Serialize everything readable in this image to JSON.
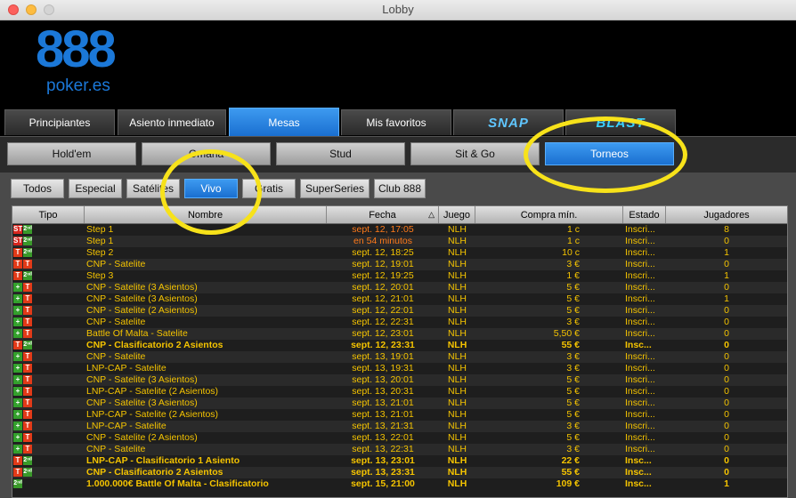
{
  "window": {
    "title": "Lobby"
  },
  "logo": {
    "number": "888",
    "text": "poker.es"
  },
  "main_tabs": [
    "Principiantes",
    "Asiento inmediato",
    "Mesas",
    "Mis favoritos",
    "SNAP",
    "BLAST"
  ],
  "main_tabs_active": "Mesas",
  "sub_tabs": [
    "Hold'em",
    "Omaha",
    "Stud",
    "Sit & Go",
    "Torneos"
  ],
  "sub_tabs_active": "Torneos",
  "filter_tabs": [
    "Todos",
    "Especial",
    "Satélites",
    "Vivo",
    "Gratis",
    "SuperSeries",
    "Club 888"
  ],
  "filter_tabs_active": "Vivo",
  "table": {
    "headers": {
      "tipo": "Tipo",
      "nombre": "Nombre",
      "fecha": "Fecha",
      "juego": "Juego",
      "compra": "Compra mín.",
      "estado": "Estado",
      "jugadores": "Jugadores"
    },
    "rows": [
      {
        "tipo": "st2",
        "nombre": "Step 1",
        "fecha": "sept. 12, 17:05",
        "juego": "NLH",
        "compra": "1 c",
        "estado": "Inscri...",
        "jugadores": "8",
        "warn": true,
        "bold": false
      },
      {
        "tipo": "st2",
        "nombre": "Step 1",
        "fecha": "en 54 minutos",
        "juego": "NLH",
        "compra": "1 c",
        "estado": "Inscri...",
        "jugadores": "0",
        "warn": true,
        "bold": false
      },
      {
        "tipo": "t2",
        "nombre": "Step 2",
        "fecha": "sept. 12, 18:25",
        "juego": "NLH",
        "compra": "10 c",
        "estado": "Inscri...",
        "jugadores": "1",
        "warn": false,
        "bold": false
      },
      {
        "tipo": "tt",
        "nombre": "CNP - Satelite",
        "fecha": "sept. 12, 19:01",
        "juego": "NLH",
        "compra": "3 €",
        "estado": "Inscri...",
        "jugadores": "0",
        "warn": false,
        "bold": false
      },
      {
        "tipo": "t2",
        "nombre": "Step 3",
        "fecha": "sept. 12, 19:25",
        "juego": "NLH",
        "compra": "1 €",
        "estado": "Inscri...",
        "jugadores": "1",
        "warn": false,
        "bold": false
      },
      {
        "tipo": "pt",
        "nombre": "CNP - Satelite (3 Asientos)",
        "fecha": "sept. 12, 20:01",
        "juego": "NLH",
        "compra": "5 €",
        "estado": "Inscri...",
        "jugadores": "0",
        "warn": false,
        "bold": false
      },
      {
        "tipo": "pt",
        "nombre": "CNP - Satelite (3 Asientos)",
        "fecha": "sept. 12, 21:01",
        "juego": "NLH",
        "compra": "5 €",
        "estado": "Inscri...",
        "jugadores": "1",
        "warn": false,
        "bold": false
      },
      {
        "tipo": "pt",
        "nombre": "CNP - Satelite (2 Asientos)",
        "fecha": "sept. 12, 22:01",
        "juego": "NLH",
        "compra": "5 €",
        "estado": "Inscri...",
        "jugadores": "0",
        "warn": false,
        "bold": false
      },
      {
        "tipo": "pt",
        "nombre": "CNP - Satelite",
        "fecha": "sept. 12, 22:31",
        "juego": "NLH",
        "compra": "3 €",
        "estado": "Inscri...",
        "jugadores": "0",
        "warn": false,
        "bold": false
      },
      {
        "tipo": "pt",
        "nombre": "Battle Of Malta - Satelite",
        "fecha": "sept. 12, 23:01",
        "juego": "NLH",
        "compra": "5,50 €",
        "estado": "Inscri...",
        "jugadores": "0",
        "warn": false,
        "bold": false
      },
      {
        "tipo": "t2",
        "nombre": "CNP - Clasificatorio 2 Asientos",
        "fecha": "sept. 12, 23:31",
        "juego": "NLH",
        "compra": "55 €",
        "estado": "Insc...",
        "jugadores": "0",
        "warn": false,
        "bold": true
      },
      {
        "tipo": "pt",
        "nombre": "CNP - Satelite",
        "fecha": "sept. 13, 19:01",
        "juego": "NLH",
        "compra": "3 €",
        "estado": "Inscri...",
        "jugadores": "0",
        "warn": false,
        "bold": false
      },
      {
        "tipo": "pt",
        "nombre": "LNP-CAP - Satelite",
        "fecha": "sept. 13, 19:31",
        "juego": "NLH",
        "compra": "3 €",
        "estado": "Inscri...",
        "jugadores": "0",
        "warn": false,
        "bold": false
      },
      {
        "tipo": "pt",
        "nombre": "CNP - Satelite (3 Asientos)",
        "fecha": "sept. 13, 20:01",
        "juego": "NLH",
        "compra": "5 €",
        "estado": "Inscri...",
        "jugadores": "0",
        "warn": false,
        "bold": false
      },
      {
        "tipo": "pt",
        "nombre": "LNP-CAP - Satelite (2 Asientos)",
        "fecha": "sept. 13, 20:31",
        "juego": "NLH",
        "compra": "5 €",
        "estado": "Inscri...",
        "jugadores": "0",
        "warn": false,
        "bold": false
      },
      {
        "tipo": "pt",
        "nombre": "CNP - Satelite (3 Asientos)",
        "fecha": "sept. 13, 21:01",
        "juego": "NLH",
        "compra": "5 €",
        "estado": "Inscri...",
        "jugadores": "0",
        "warn": false,
        "bold": false
      },
      {
        "tipo": "pt",
        "nombre": "LNP-CAP - Satelite (2 Asientos)",
        "fecha": "sept. 13, 21:01",
        "juego": "NLH",
        "compra": "5 €",
        "estado": "Inscri...",
        "jugadores": "0",
        "warn": false,
        "bold": false
      },
      {
        "tipo": "pt",
        "nombre": "LNP-CAP - Satelite",
        "fecha": "sept. 13, 21:31",
        "juego": "NLH",
        "compra": "3 €",
        "estado": "Inscri...",
        "jugadores": "0",
        "warn": false,
        "bold": false
      },
      {
        "tipo": "pt",
        "nombre": "CNP - Satelite (2 Asientos)",
        "fecha": "sept. 13, 22:01",
        "juego": "NLH",
        "compra": "5 €",
        "estado": "Inscri...",
        "jugadores": "0",
        "warn": false,
        "bold": false
      },
      {
        "tipo": "pt",
        "nombre": "CNP - Satelite",
        "fecha": "sept. 13, 22:31",
        "juego": "NLH",
        "compra": "3 €",
        "estado": "Inscri...",
        "jugadores": "0",
        "warn": false,
        "bold": false
      },
      {
        "tipo": "t2",
        "nombre": "LNP-CAP - Clasificatorio 1 Asiento",
        "fecha": "sept. 13, 23:01",
        "juego": "NLH",
        "compra": "22 €",
        "estado": "Insc...",
        "jugadores": "0",
        "warn": false,
        "bold": true
      },
      {
        "tipo": "t2",
        "nombre": "CNP - Clasificatorio 2 Asientos",
        "fecha": "sept. 13, 23:31",
        "juego": "NLH",
        "compra": "55 €",
        "estado": "Insc...",
        "jugadores": "0",
        "warn": false,
        "bold": true
      },
      {
        "tipo": "n2",
        "nombre": "1.000.000€ Battle Of Malta - Clasificatorio",
        "fecha": "sept. 15, 21:00",
        "juego": "NLH",
        "compra": "109 €",
        "estado": "Insc...",
        "jugadores": "1",
        "warn": false,
        "bold": true
      }
    ]
  },
  "colors": {
    "accent": "#1a6fd0",
    "row_text": "#f5c400",
    "warn_text": "#ff7a1a",
    "highlight": "#f7e21a"
  }
}
